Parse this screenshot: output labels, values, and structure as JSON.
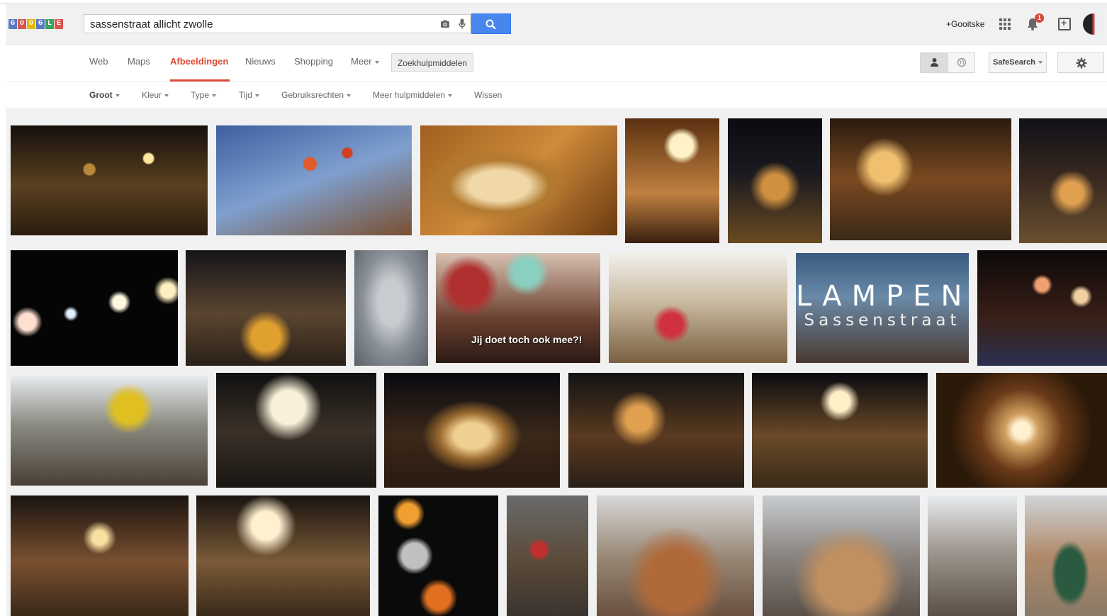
{
  "header": {
    "logo_letters": [
      "G",
      "O",
      "O",
      "G",
      "L",
      "E"
    ],
    "logo_colors": [
      "#5b7cc4",
      "#d9534f",
      "#e8b800",
      "#5b7cc4",
      "#3aa35a",
      "#d9534f"
    ],
    "search_value": "sassenstraat allicht zwolle",
    "user_label": "+Gooitske",
    "notification_count": "1"
  },
  "nav": {
    "tabs": [
      "Web",
      "Maps",
      "Afbeeldingen",
      "Nieuws",
      "Shopping",
      "Meer"
    ],
    "active_tab": "Afbeeldingen",
    "tools_button": "Zoekhulpmiddelen",
    "safesearch": "SafeSearch"
  },
  "tools": {
    "items": [
      "Groot",
      "Kleur",
      "Type",
      "Tijd",
      "Gebruiksrechten",
      "Meer hulpmiddelen",
      "Wissen"
    ]
  },
  "results": {
    "overlay_texts": {
      "campaign": "Jij doet toch ook mee?!",
      "lampen_title": "LAMPEN",
      "lampen_subtitle": "Sassenstraat"
    }
  },
  "colors": {
    "accent": "#dd4b39",
    "search_button": "#4787ed"
  }
}
